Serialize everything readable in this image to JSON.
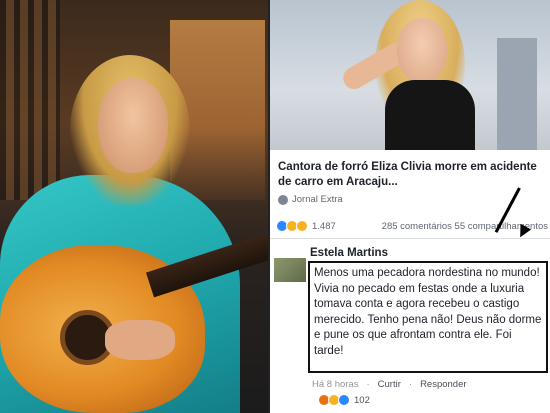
{
  "news": {
    "title": "Cantora de forró Eliza Clivia morre em acidente de carro em Aracaju...",
    "source": "Jornal Extra"
  },
  "reactions": {
    "count": "1.487",
    "stats": "285 comentários 55 compartilhamentos",
    "icons": [
      "like-icon",
      "haha-icon",
      "wow-icon"
    ]
  },
  "comment": {
    "author": "Estela Martins",
    "text": "Menos uma pecadora nordestina no mundo! Vivia no pecado em festas onde a luxuria tomava conta e agora recebeu o castigo merecido. Tenho pena não! Deus não dorme e pune os que afrontam contra ele. Foi tarde!",
    "time": "Há 8 horas",
    "like_label": "Curtir",
    "reply_label": "Responder",
    "reaction_count": "102",
    "reaction_icons": [
      "angry-icon",
      "sad-icon",
      "like-icon"
    ]
  },
  "colors": {
    "facebook_blue": "#2d88ff",
    "text_dark": "#1d2129",
    "text_muted": "#616770"
  }
}
